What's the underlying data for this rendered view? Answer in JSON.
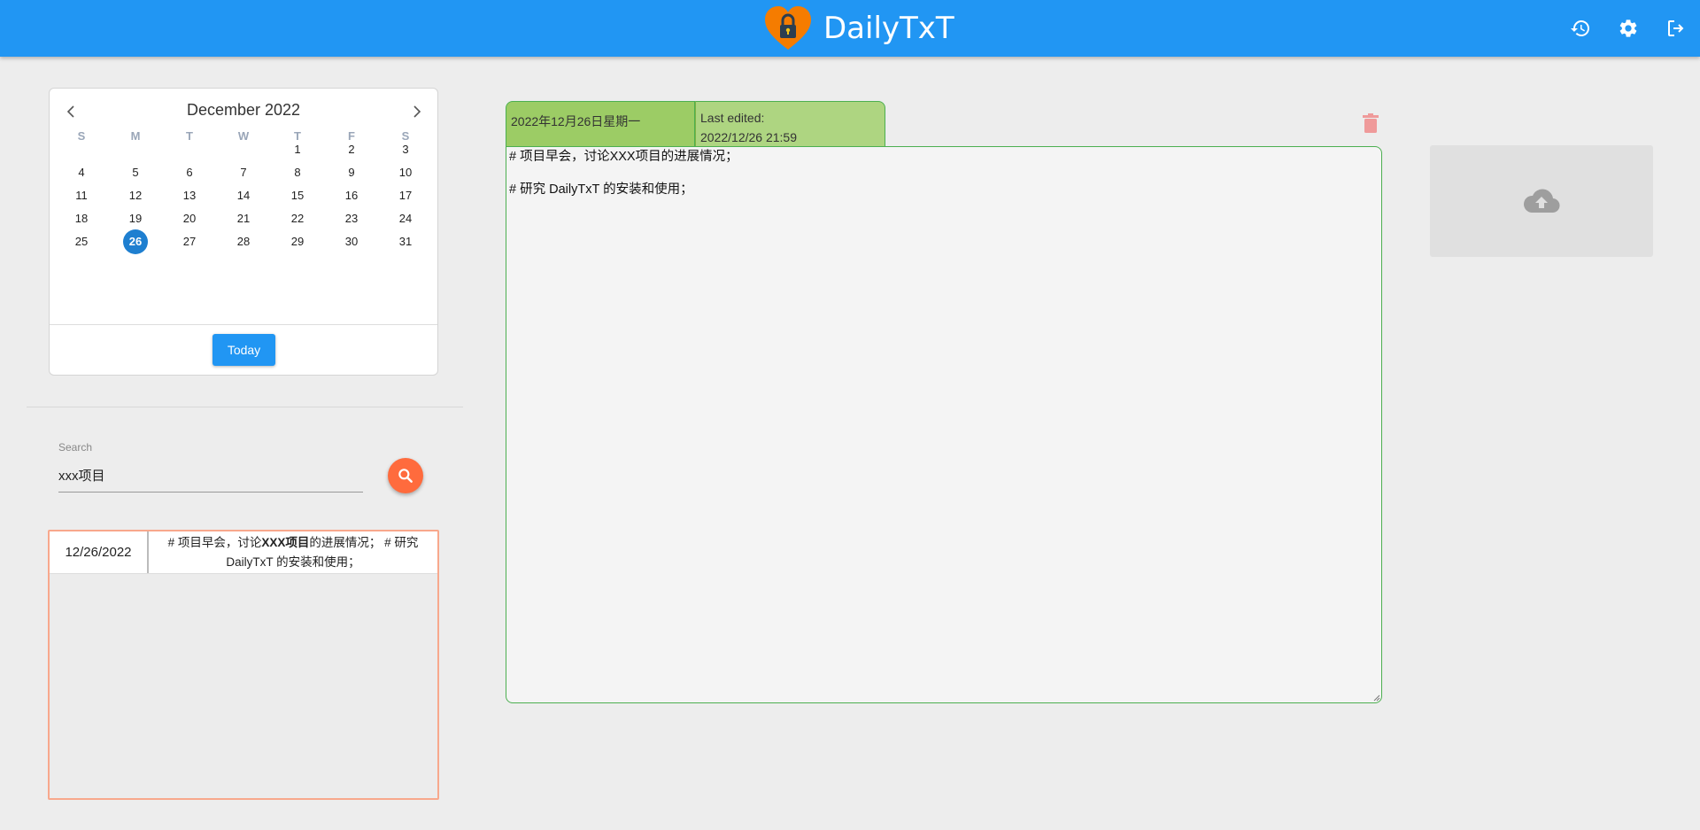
{
  "header": {
    "title": "DailyTxT",
    "icons": {
      "history": "history-icon",
      "settings": "gear-icon",
      "logout": "logout-icon",
      "logo": "heart-lock-logo"
    },
    "colors": {
      "bar": "#2196f3",
      "logo": "#f57c00"
    }
  },
  "calendar": {
    "month_title": "December 2022",
    "weekdays": [
      "S",
      "M",
      "T",
      "W",
      "T",
      "F",
      "S"
    ],
    "weeks": [
      [
        "",
        "",
        "",
        "",
        "1",
        "2",
        "3"
      ],
      [
        "4",
        "5",
        "6",
        "7",
        "8",
        "9",
        "10"
      ],
      [
        "11",
        "12",
        "13",
        "14",
        "15",
        "16",
        "17"
      ],
      [
        "18",
        "19",
        "20",
        "21",
        "22",
        "23",
        "24"
      ],
      [
        "25",
        "26",
        "27",
        "28",
        "29",
        "30",
        "31"
      ]
    ],
    "selected_day": "26",
    "today_label": "Today"
  },
  "search": {
    "label": "Search",
    "value": "xxx项目"
  },
  "results": [
    {
      "date": "12/26/2022",
      "text_before": "# 项目早会，讨论",
      "text_match": "XXX项目",
      "text_after": "的进展情况；  # 研究 DailyTxT 的安装和使用；"
    }
  ],
  "entry": {
    "date_label": "2022年12月26日星期一",
    "last_edited_label": "Last edited:",
    "last_edited_value": "2022/12/26 21:59",
    "lines": [
      "# 项目早会，讨论XXX项目的进展情况；",
      "# 研究 DailyTxT 的安装和使用；"
    ]
  },
  "colors": {
    "accent": "#2196f3",
    "search_button": "#ff6b3d",
    "date_tab": "#9ccc65",
    "edited_tab": "#aed581",
    "editor_border": "#4caf50",
    "results_border": "#f8a88c",
    "trash": "#ef9a9a"
  }
}
